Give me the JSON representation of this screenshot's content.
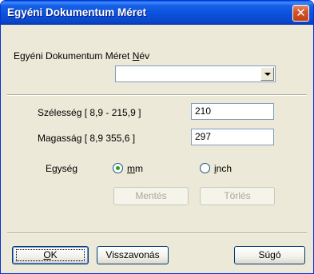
{
  "window": {
    "title": "Egyéni Dokumentum Méret",
    "close_symbol": "✕"
  },
  "name_section": {
    "label_prefix": "Egyéni Dokumentum Méret ",
    "label_accel": "N",
    "label_suffix": "év",
    "value": ""
  },
  "width": {
    "label": "Szélesség [  8,9 -  215,9 ]",
    "value": "210"
  },
  "height": {
    "label": "Magasság [  8,9    355,6 ]",
    "value": "297"
  },
  "unit": {
    "label": "Egység",
    "options": [
      {
        "accel": "m",
        "rest": "m",
        "checked": true
      },
      {
        "accel": "i",
        "rest": "nch",
        "checked": false
      }
    ]
  },
  "actions": {
    "save": "Mentés",
    "delete": "Törlés"
  },
  "footer": {
    "ok_accel": "O",
    "ok_rest": "K",
    "cancel": "Visszavonás",
    "help": "Súgó"
  }
}
